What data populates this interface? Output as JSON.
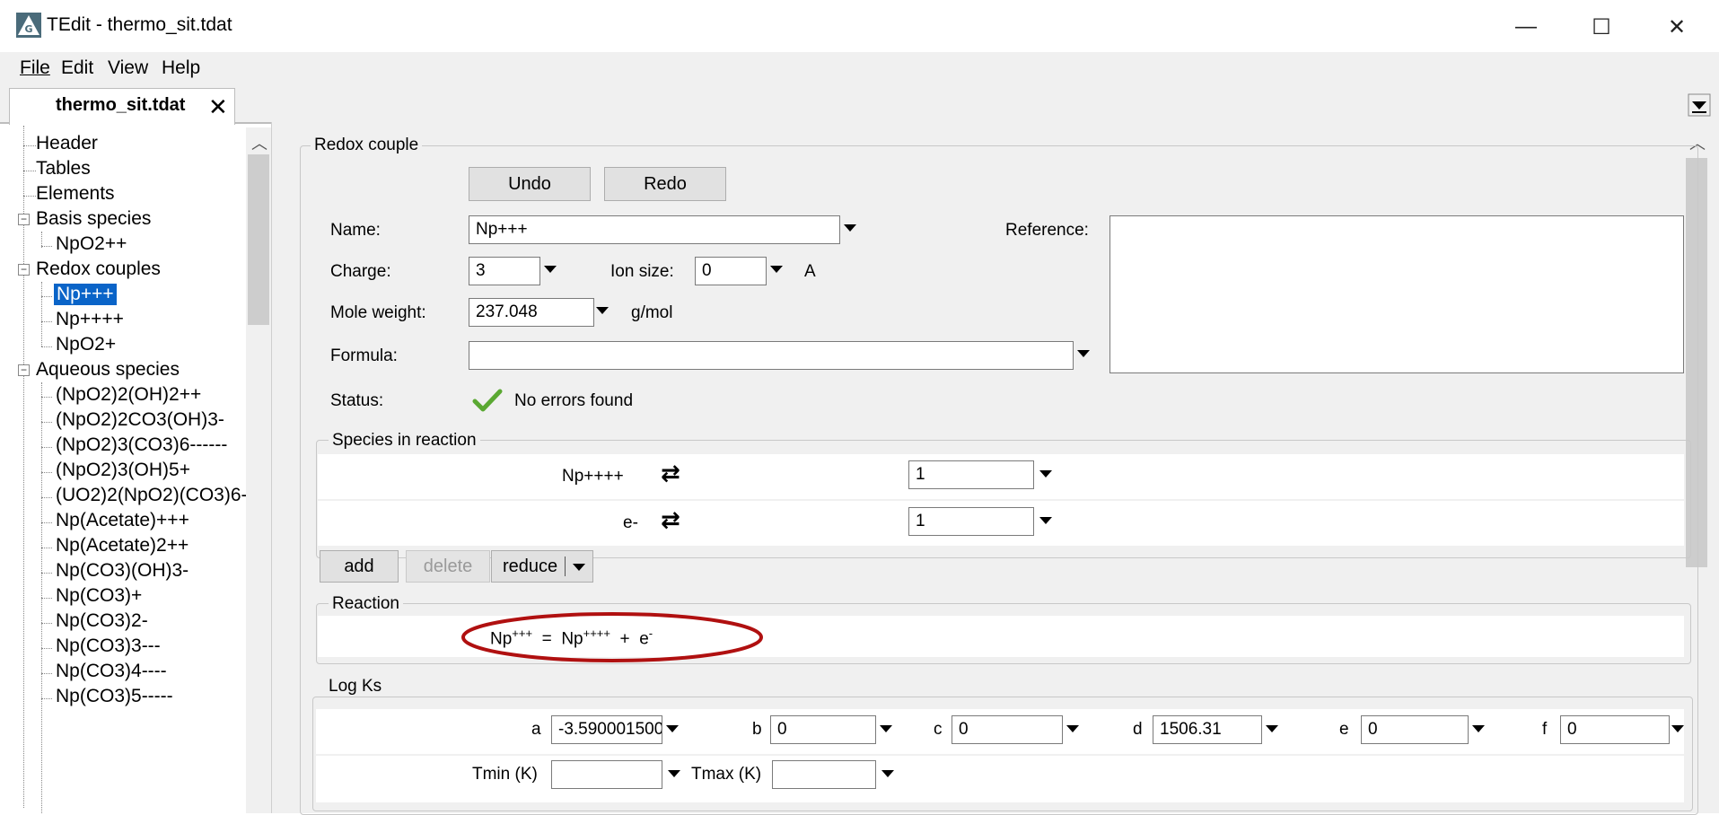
{
  "window": {
    "title": "TEdit - thermo_sit.tdat",
    "minimize": "—",
    "maximize": "☐",
    "close": "✕"
  },
  "menu": {
    "file": "File",
    "edit": "Edit",
    "view": "View",
    "help": "Help"
  },
  "tab": {
    "label": "thermo_sit.tdat",
    "close": "✕"
  },
  "tree": {
    "header": "Header",
    "tables": "Tables",
    "elements": "Elements",
    "basis_species": "Basis species",
    "basis_items": [
      "NpO2++"
    ],
    "redox_couples": "Redox couples",
    "redox_items": [
      "Np+++",
      "Np++++",
      "NpO2+"
    ],
    "aqueous_species": "Aqueous species",
    "aqueous_items": [
      "(NpO2)2(OH)2++",
      "(NpO2)2CO3(OH)3-",
      "(NpO2)3(CO3)6------",
      "(NpO2)3(OH)5+",
      "(UO2)2(NpO2)(CO3)6-",
      "Np(Acetate)+++",
      "Np(Acetate)2++",
      "Np(CO3)(OH)3-",
      "Np(CO3)+",
      "Np(CO3)2-",
      "Np(CO3)3---",
      "Np(CO3)4----",
      "Np(CO3)5-----"
    ]
  },
  "redox": {
    "group_title": "Redox couple",
    "undo": "Undo",
    "redo": "Redo",
    "name_label": "Name:",
    "name_value": "Np+++",
    "reference_label": "Reference:",
    "charge_label": "Charge:",
    "charge_value": "3",
    "ion_size_label": "Ion size:",
    "ion_size_value": "0",
    "ion_size_unit": "A",
    "mole_weight_label": "Mole weight:",
    "mole_weight_value": "237.048",
    "mole_weight_unit": "g/mol",
    "formula_label": "Formula:",
    "formula_value": "",
    "status_label": "Status:",
    "status_text": "No errors found"
  },
  "species": {
    "group_title": "Species in reaction",
    "rows": [
      {
        "name": "Np++++",
        "coef": "1"
      },
      {
        "name": "e-",
        "coef": "1"
      }
    ],
    "add": "add",
    "delete": "delete",
    "reduce": "reduce"
  },
  "reaction": {
    "group_title": "Reaction",
    "left": "Np",
    "left_sup": "+++",
    "equals": "=",
    "right": "Np",
    "right_sup": "++++",
    "plus": "+",
    "e": "e",
    "e_sup": "-"
  },
  "logks": {
    "group_title": "Log Ks",
    "a_label": "a",
    "a_value": "-3.590001500",
    "b_label": "b",
    "b_value": "0",
    "c_label": "c",
    "c_value": "0",
    "d_label": "d",
    "d_value": "1506.31",
    "e_label": "e",
    "e_value": "0",
    "f_label": "f",
    "f_value": "0",
    "tmin_label": "Tmin (K)",
    "tmin_value": "",
    "tmax_label": "Tmax (K)",
    "tmax_value": ""
  },
  "colors": {
    "selection": "#0a64c8",
    "check": "#5aa832",
    "highlight_ellipse": "#b01010"
  }
}
